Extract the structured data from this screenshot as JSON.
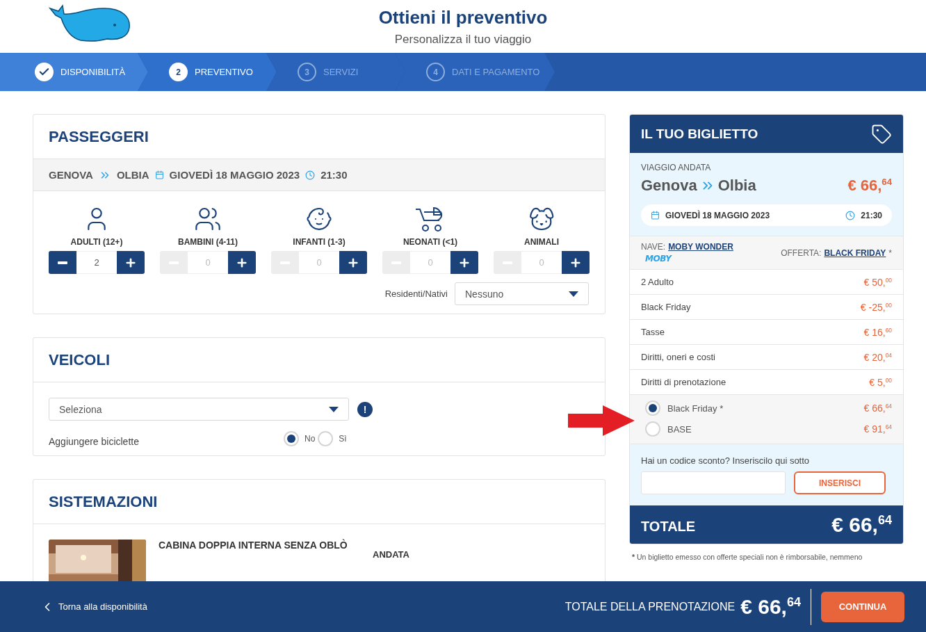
{
  "header": {
    "title": "Ottieni il preventivo",
    "subtitle": "Personalizza il tuo viaggio"
  },
  "steps": [
    {
      "label": "DISPONIBILITÀ",
      "completed": true,
      "selected": false
    },
    {
      "number": "2",
      "label": "PREVENTIVO",
      "completed": false,
      "selected": true
    },
    {
      "number": "3",
      "label": "SERVIZI",
      "completed": false,
      "selected": false
    },
    {
      "number": "4",
      "label": "DATI E PAGAMENTO",
      "completed": false,
      "selected": false
    }
  ],
  "passengers": {
    "title": "PASSEGGERI",
    "route": {
      "from": "GENOVA",
      "to": "OLBIA",
      "date": "GIOVEDÌ 18 MAGGIO 2023",
      "time": "21:30"
    },
    "categories": [
      {
        "kind": "adult",
        "label": "ADULTI (12+)",
        "value": "2",
        "minus_disabled": false
      },
      {
        "kind": "child",
        "label": "BAMBINI (4-11)",
        "value": "0",
        "minus_disabled": true
      },
      {
        "kind": "infant",
        "label": "INFANTI (1-3)",
        "value": "0",
        "minus_disabled": true
      },
      {
        "kind": "newborn",
        "label": "NEONATI (<1)",
        "value": "0",
        "minus_disabled": true
      },
      {
        "kind": "animal",
        "label": "ANIMALI",
        "value": "0",
        "minus_disabled": true
      }
    ],
    "residents": {
      "label": "Residenti/Nativi",
      "value": "Nessuno"
    }
  },
  "vehicles": {
    "title": "VEICOLI",
    "select": {
      "value": "Seleziona"
    },
    "info_mark": "!",
    "bikes": {
      "label": "Aggiungere biciclette",
      "options": [
        {
          "label": "No",
          "selected": true
        },
        {
          "label": "Sì",
          "selected": false
        }
      ]
    }
  },
  "accommodations": {
    "title": "SISTEMAZIONI",
    "items": [
      {
        "kind": "picture",
        "name": "CABINA DOPPIA INTERNA SENZA OBLÒ",
        "direction": "ANDATA"
      }
    ]
  },
  "ticket": {
    "title": "IL TUO BIGLIETTO",
    "trip_label": "VIAGGIO ANDATA",
    "from": "Genova",
    "to": "Olbia",
    "price": "€ 66,$^{64}$",
    "date": "GIOVEDÌ 18 MAGGIO 2023",
    "time": "21:30",
    "ship_label": "NAVE:",
    "ship": "MOBY WONDER",
    "operator_logo": "MOBY",
    "offer_label": "OFFERTA:",
    "offer": "BLACK FRIDAY",
    "offer_mark": "*",
    "lines": [
      {
        "label": "2 Adulto",
        "amount": "€ 50,$^{00}$"
      },
      {
        "label": "Black Friday",
        "amount": "€ -25,$^{00}$"
      },
      {
        "label": "Tasse",
        "amount": "€ 16,$^{60}$"
      },
      {
        "label": "Diritti, oneri e costi",
        "amount": "€ 20,$^{04}$"
      },
      {
        "label": "Diritti di prenotazione",
        "amount": "€ 5,$^{00}$"
      }
    ],
    "fares": [
      {
        "label": "Black Friday *",
        "amount": "€ 66,$^{64}$",
        "selected": true
      },
      {
        "label": "BASE",
        "amount": "€ 91,$^{64}$",
        "selected": false
      }
    ],
    "discount": {
      "prompt": "Hai un codice sconto? Inseriscilo qui sotto",
      "button": "INSERISCI"
    },
    "total_label": "TOTALE",
    "total": "€ 66,$^{64}$",
    "footnote_mark": "*",
    "footnote": "Un biglietto emesso con offerte speciali non è rimborsabile, nemmeno"
  },
  "callout": {
    "kind": "arrow",
    "color": "#e31e24"
  },
  "footer": {
    "back": "Torna alla disponibilità",
    "total_label": "TOTALE DELLA PRENOTAZIONE",
    "total": "€ 66,$^{64}$",
    "button": "CONTINUA"
  }
}
